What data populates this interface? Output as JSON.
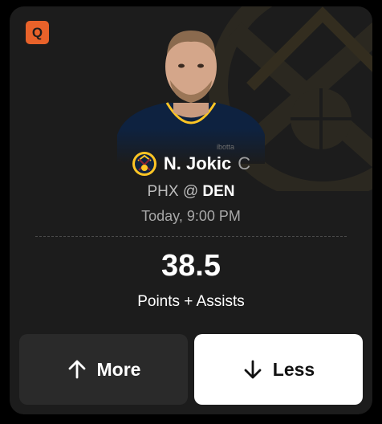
{
  "badge": {
    "label": "Q",
    "color": "#e8622a"
  },
  "player": {
    "name": "N. Jokic",
    "position": "C",
    "team_logo_icon": "nuggets-logo-icon",
    "headshot": "player-headshot"
  },
  "matchup": {
    "away": "PHX",
    "separator": "@",
    "home": "DEN"
  },
  "game_time": "Today, 9:00 PM",
  "projection": {
    "line": "38.5",
    "stat": "Points + Assists"
  },
  "actions": {
    "more": {
      "label": "More",
      "icon": "arrow-up-icon"
    },
    "less": {
      "label": "Less",
      "icon": "arrow-down-icon"
    }
  },
  "colors": {
    "card_bg": "#1c1c1c",
    "accent": "#e8622a",
    "team_gold": "#fec524",
    "team_navy": "#0e2240"
  }
}
